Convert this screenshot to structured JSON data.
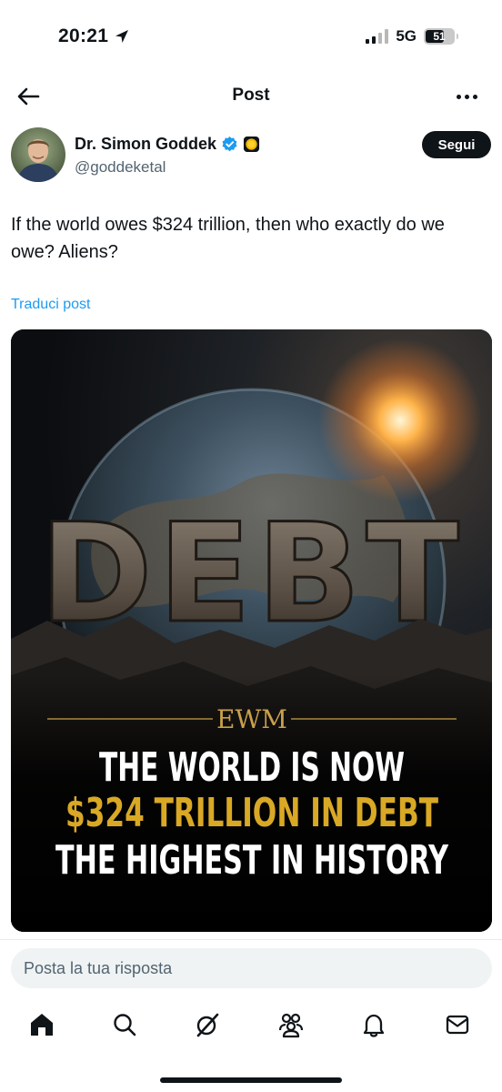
{
  "status_bar": {
    "time": "20:21",
    "network": "5G",
    "battery": "51"
  },
  "header": {
    "title": "Post"
  },
  "author": {
    "display_name": "Dr. Simon Goddek",
    "handle": "@goddeketal",
    "follow_label": "Segui"
  },
  "post": {
    "text": "If the world owes $324 trillion, then who exactly do we owe? Aliens?",
    "translate_label": "Traduci post"
  },
  "media": {
    "debt_word": "DEBT",
    "logo": "EWM",
    "headline_line1": "THE WORLD IS NOW",
    "headline_line2": "$324 TRILLION IN DEBT",
    "headline_line3": "THE HIGHEST IN HISTORY",
    "headline_accent_color": "#d9a825"
  },
  "reply": {
    "placeholder": "Posta la tua risposta"
  },
  "nav": {
    "icons": [
      "home-icon",
      "search-icon",
      "grok-icon",
      "communities-icon",
      "notifications-icon",
      "messages-icon"
    ]
  },
  "colors": {
    "text": "#0f1419",
    "secondary": "#536471",
    "link": "#1d9bf0",
    "verified": "#1d9bf0"
  }
}
